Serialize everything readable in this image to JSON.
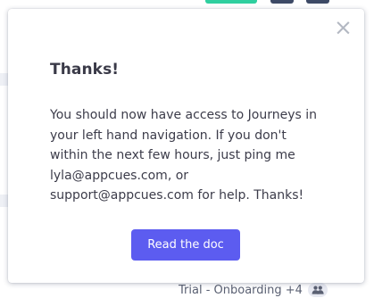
{
  "modal": {
    "title": "Thanks!",
    "body_lines": [
      "You should now have access to Journeys in",
      "your left hand navigation. If you don't",
      "within the next few hours, just ping me",
      "lyla@appcues.com, or",
      "support@appcues.com for help. Thanks!"
    ],
    "cta_label": "Read the doc",
    "close_glyph": "×",
    "close_icon": "close-icon"
  },
  "footer": {
    "label": "Trial - Onboarding +4",
    "badge_icon": "people-icon"
  },
  "colors": {
    "accent": "#5c5cf0",
    "title_text": "#3a3a48",
    "body_text": "#3c3c4a",
    "close_icon": "#b3b8c2",
    "footer_text": "#5a6072",
    "badge_bg": "#e7e9f1",
    "top_pill_green": "#2fcf9f",
    "top_pill_navy": "#3d4a66"
  }
}
